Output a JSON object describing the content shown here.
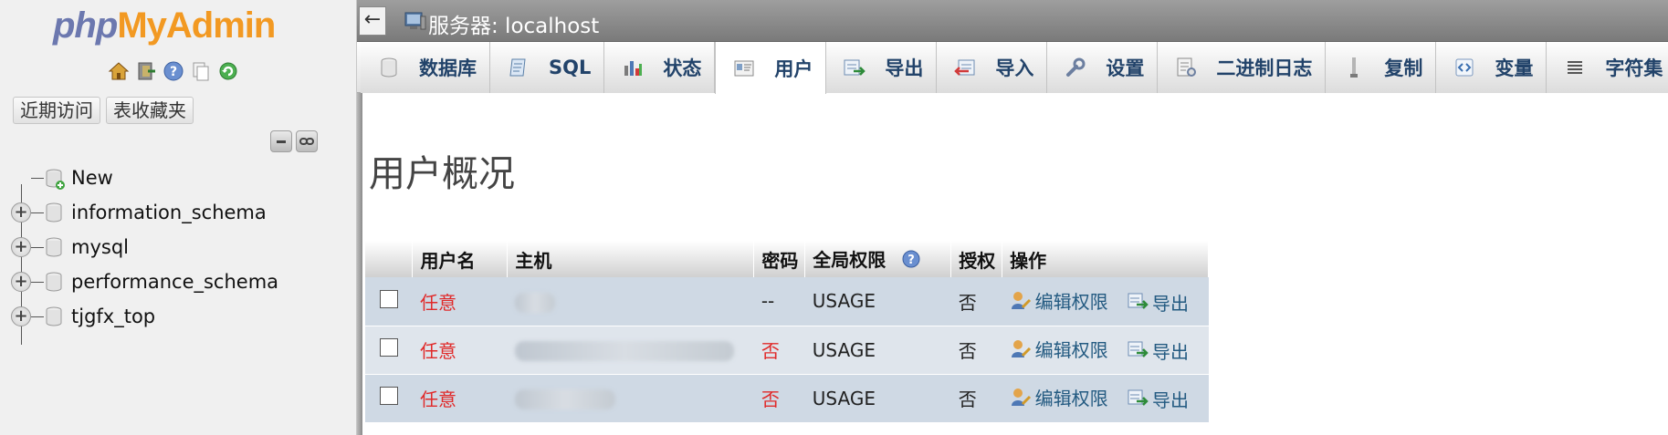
{
  "sidebar": {
    "logo": {
      "php": "php",
      "my": "My",
      "admin": "Admin"
    },
    "quick_icons": [
      "home-icon",
      "exit-icon",
      "help-icon",
      "copy-icon",
      "reload-icon"
    ],
    "nav_buttons": [
      "近期访问",
      "表收藏夹"
    ],
    "tree": [
      {
        "label": "New",
        "expandable": false
      },
      {
        "label": "information_schema",
        "expandable": true
      },
      {
        "label": "mysql",
        "expandable": true
      },
      {
        "label": "performance_schema",
        "expandable": true
      },
      {
        "label": "tjgfx_top",
        "expandable": true
      }
    ]
  },
  "topbar": {
    "back": "←",
    "server_label": "服务器: localhost"
  },
  "tabs": [
    {
      "label": "数据库",
      "icon": "database-icon",
      "active": false
    },
    {
      "label": "SQL",
      "icon": "sql-icon",
      "active": false
    },
    {
      "label": "状态",
      "icon": "status-icon",
      "active": false
    },
    {
      "label": "用户",
      "icon": "users-icon",
      "active": true
    },
    {
      "label": "导出",
      "icon": "export-icon",
      "active": false
    },
    {
      "label": "导入",
      "icon": "import-icon",
      "active": false
    },
    {
      "label": "设置",
      "icon": "settings-icon",
      "active": false
    },
    {
      "label": "二进制日志",
      "icon": "binlog-icon",
      "active": false
    },
    {
      "label": "复制",
      "icon": "replication-icon",
      "active": false
    },
    {
      "label": "变量",
      "icon": "variables-icon",
      "active": false
    },
    {
      "label": "字符集",
      "icon": "charset-icon",
      "active": false
    }
  ],
  "main": {
    "title": "用户概况",
    "table": {
      "headers": [
        "用户名",
        "主机",
        "密码",
        "全局权限",
        "授权",
        "操作"
      ],
      "rows": [
        {
          "user": "任意",
          "password": "--",
          "password_red": false,
          "privileges": "USAGE",
          "grant": "否",
          "edit": "编辑权限",
          "export": "导出"
        },
        {
          "user": "任意",
          "password": "否",
          "password_red": true,
          "privileges": "USAGE",
          "grant": "否",
          "edit": "编辑权限",
          "export": "导出"
        },
        {
          "user": "任意",
          "password": "否",
          "password_red": true,
          "privileges": "USAGE",
          "grant": "否",
          "edit": "编辑权限",
          "export": "导出"
        }
      ]
    }
  },
  "colors": {
    "accent": "#235a81",
    "red": "#e02a2a",
    "row": "#cfd9e4"
  }
}
